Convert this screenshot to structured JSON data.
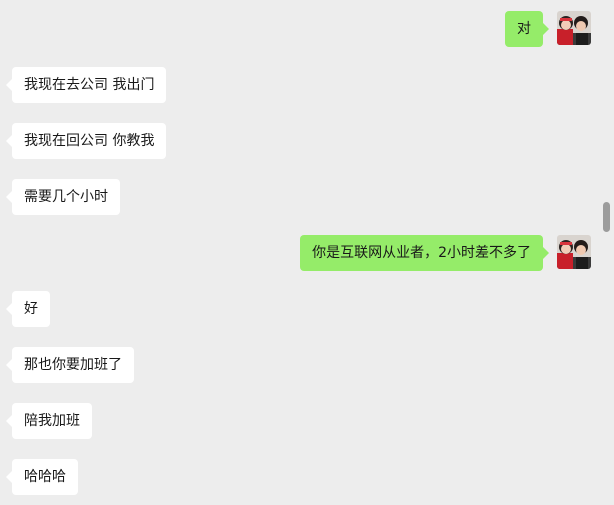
{
  "messages": [
    {
      "side": "out",
      "text": "对"
    },
    {
      "side": "in",
      "text": "我现在去公司  我出门"
    },
    {
      "side": "in",
      "text": "我现在回公司  你教我"
    },
    {
      "side": "in",
      "text": "需要几个小时"
    },
    {
      "side": "out",
      "text": "你是互联网从业者，2小时差不多了"
    },
    {
      "side": "in",
      "text": "好"
    },
    {
      "side": "in",
      "text": "那也你要加班了"
    },
    {
      "side": "in",
      "text": "陪我加班"
    },
    {
      "side": "in",
      "text": "哈哈哈"
    }
  ],
  "colors": {
    "background": "#ededed",
    "outgoing_bubble": "#95ec69",
    "incoming_bubble": "#ffffff",
    "text": "#191919",
    "scrollbar": "#9c9c9c"
  },
  "icons": {
    "sender_avatar": "avatar-photo-couple"
  }
}
